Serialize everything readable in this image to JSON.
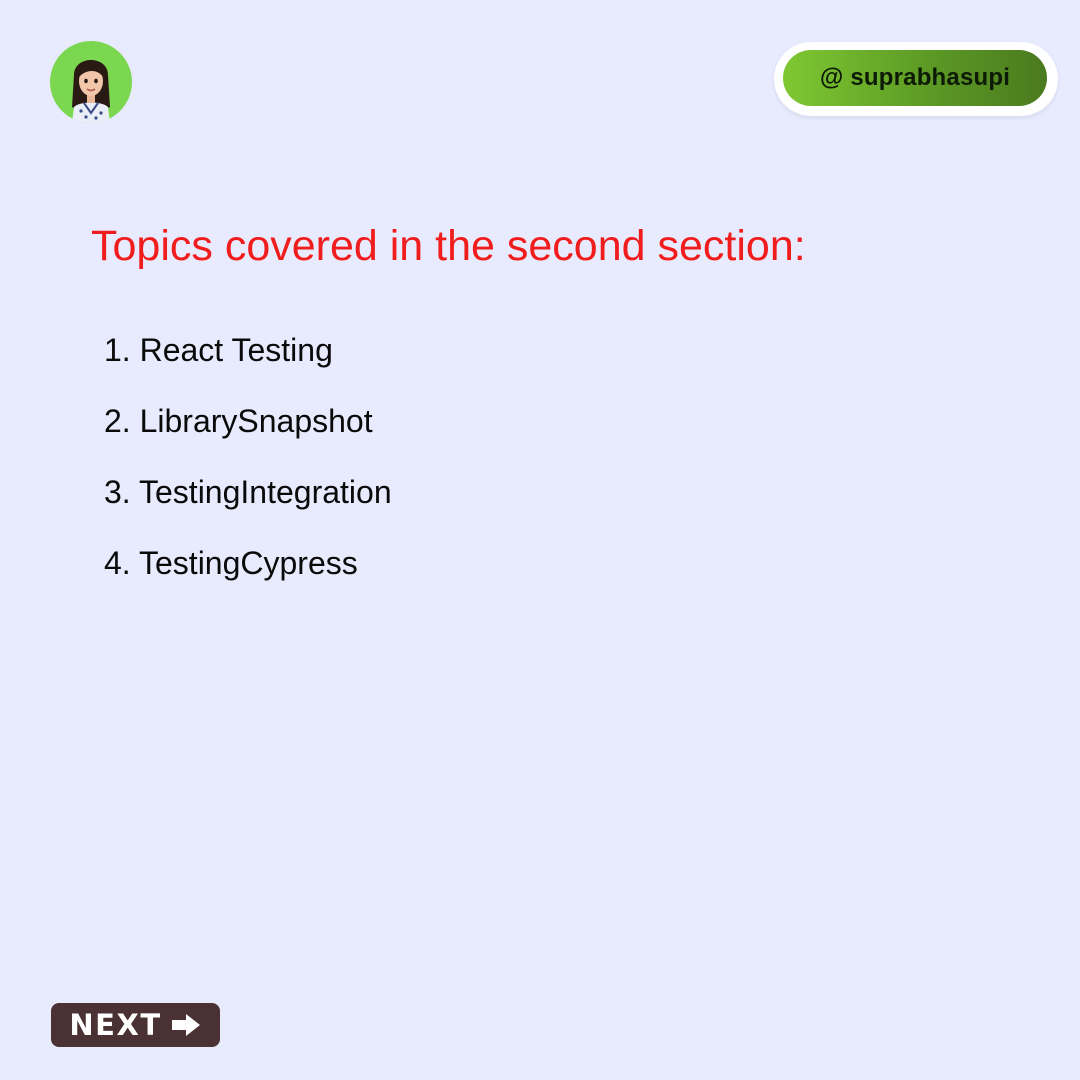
{
  "header": {
    "handle": "@ suprabhasupi"
  },
  "main": {
    "title": "Topics covered in the second section:",
    "topics": [
      "1. React Testing",
      "2. LibrarySnapshot",
      "3. TestingIntegration",
      "4. TestingCypress"
    ]
  },
  "footer": {
    "next_label": "NEXT",
    "next_icon": "arrow-right-icon"
  },
  "colors": {
    "background": "#e8ebfe",
    "title": "#f11d1d",
    "avatar_bg": "#7bd74f",
    "handle_green": "#6aaa2b",
    "next_bg": "#4a3234"
  },
  "icons": {
    "avatar": "avatar-icon"
  }
}
